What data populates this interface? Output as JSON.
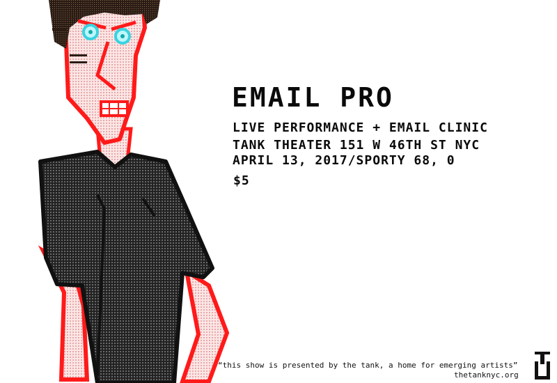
{
  "poster": {
    "title": "EMAIL PRO",
    "line1": "LIVE PERFORMANCE + EMAIL CLINIC",
    "line2": "TANK THEATER 151 W 46TH ST NYC",
    "line3": "APRIL 13, 2017/SPORTY 68, 0",
    "price": "$5"
  },
  "footer": {
    "tagline": "“this show is presented by the tank, a home for emerging artists”",
    "website": "thetanknyc.org"
  },
  "colors": {
    "outline": "#ff1a1a",
    "skin": "#f4c9c9",
    "shirt": "#2b2b2b",
    "hair": "#3a2a20",
    "eyes": "#39d3e0",
    "text": "#0a0a0a"
  },
  "figure": {
    "description_icon": "pixel-art-man-illustration"
  }
}
